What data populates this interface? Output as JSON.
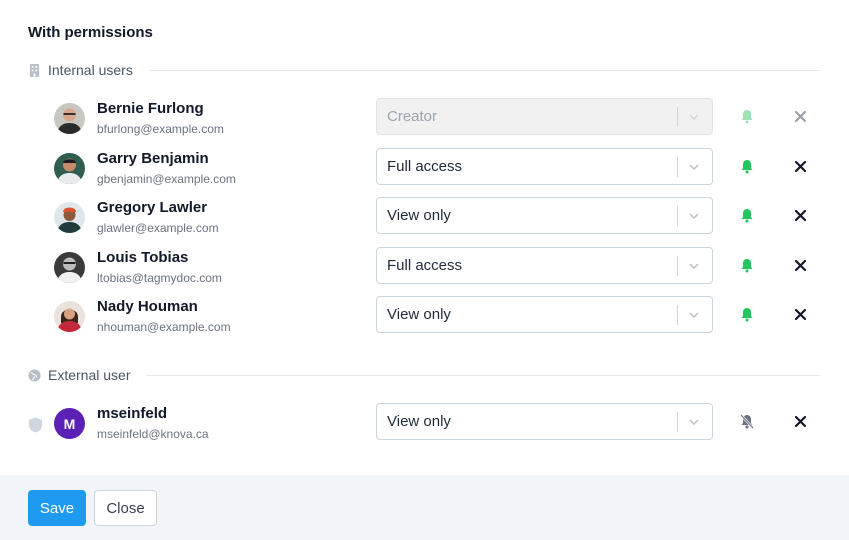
{
  "title": "With permissions",
  "sections": {
    "internal": {
      "label": "Internal users",
      "icon": "building-icon"
    },
    "external": {
      "label": "External user",
      "icon": "globe-icon"
    }
  },
  "users": [
    {
      "name": "Bernie Furlong",
      "email": "bfurlong@example.com",
      "permission": "Creator",
      "disabled": true,
      "notify": true,
      "avatar": "avatar-photo"
    },
    {
      "name": "Garry Benjamin",
      "email": "gbenjamin@example.com",
      "permission": "Full access",
      "disabled": false,
      "notify": true,
      "avatar": "avatar-photo"
    },
    {
      "name": "Gregory Lawler",
      "email": "glawler@example.com",
      "permission": "View only",
      "disabled": false,
      "notify": true,
      "avatar": "avatar-photo"
    },
    {
      "name": "Louis Tobias",
      "email": "ltobias@tagmydoc.com",
      "permission": "Full access",
      "disabled": false,
      "notify": true,
      "avatar": "avatar-photo"
    },
    {
      "name": "Nady Houman",
      "email": "nhouman@example.com",
      "permission": "View only",
      "disabled": false,
      "notify": true,
      "avatar": "avatar-photo"
    }
  ],
  "external_users": [
    {
      "name": "mseinfeld",
      "email": "mseinfeld@knova.ca",
      "permission": "View only",
      "initial": "M",
      "notify": false
    }
  ],
  "colors": {
    "bell_on": "#22c55e",
    "bell_off": "#6b7280",
    "save": "#1e9bf0",
    "avatar_letter_bg": "#5b21b6"
  },
  "footer": {
    "save_label": "Save",
    "close_label": "Close"
  }
}
